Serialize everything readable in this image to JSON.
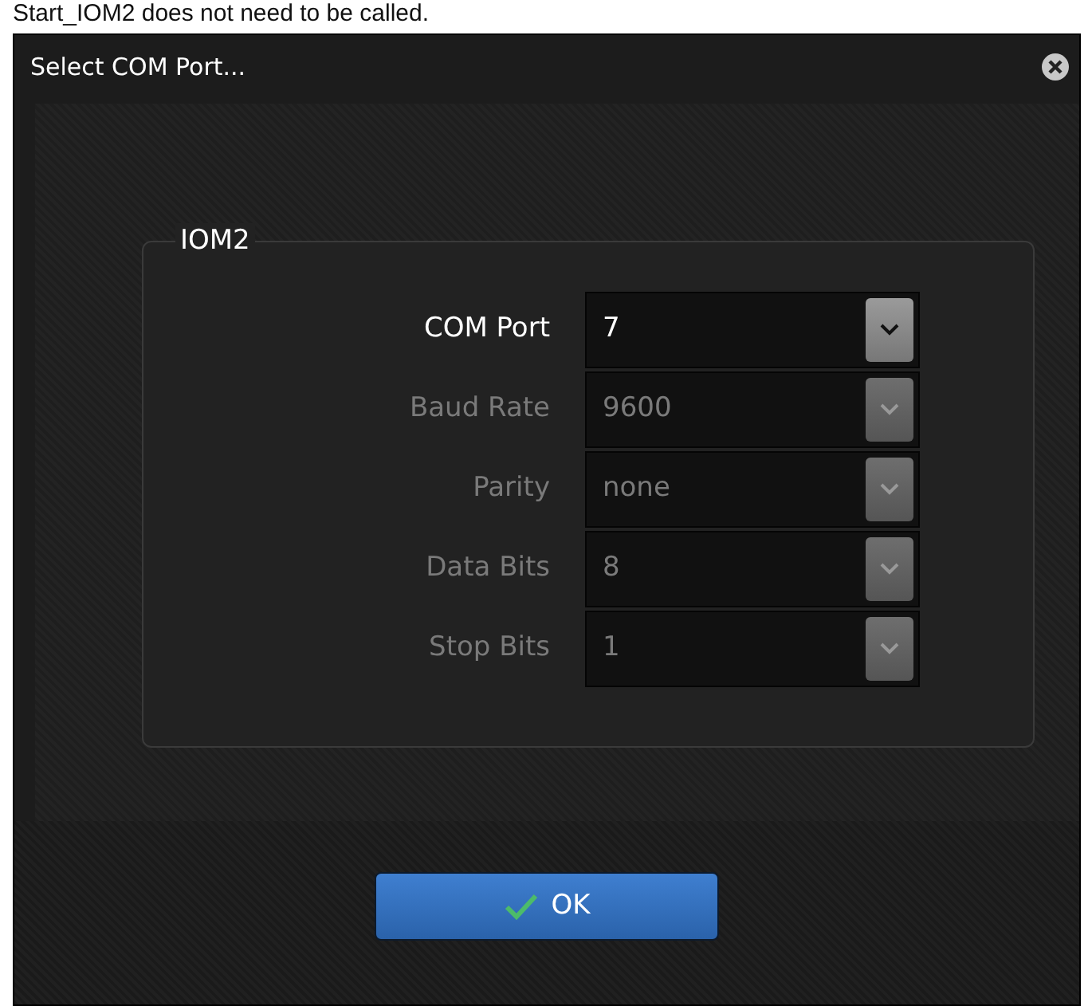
{
  "caption": "Start_IOM2 does not need to be called.",
  "window": {
    "title": "Select COM Port..."
  },
  "group": {
    "title": "IOM2",
    "fields": [
      {
        "label": "COM Port",
        "value": "7",
        "disabled": false
      },
      {
        "label": "Baud Rate",
        "value": "9600",
        "disabled": true
      },
      {
        "label": "Parity",
        "value": "none",
        "disabled": true
      },
      {
        "label": "Data Bits",
        "value": "8",
        "disabled": true
      },
      {
        "label": "Stop Bits",
        "value": "1",
        "disabled": true
      }
    ]
  },
  "buttons": [
    {
      "label": "OK"
    }
  ]
}
